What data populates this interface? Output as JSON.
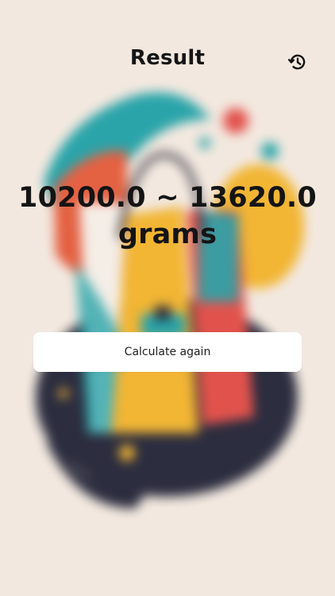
{
  "header": {
    "title": "Result",
    "history_icon": "history-icon"
  },
  "result": {
    "value": "10200.0 ~ 13620.0 grams"
  },
  "actions": {
    "calculate_again_label": "Calculate again"
  },
  "colors": {
    "background": "#f2e8df",
    "teal": "#20a1a7",
    "orange": "#e45a3a",
    "yellow": "#f2b32b",
    "navy": "#222437",
    "red": "#e24b45"
  }
}
